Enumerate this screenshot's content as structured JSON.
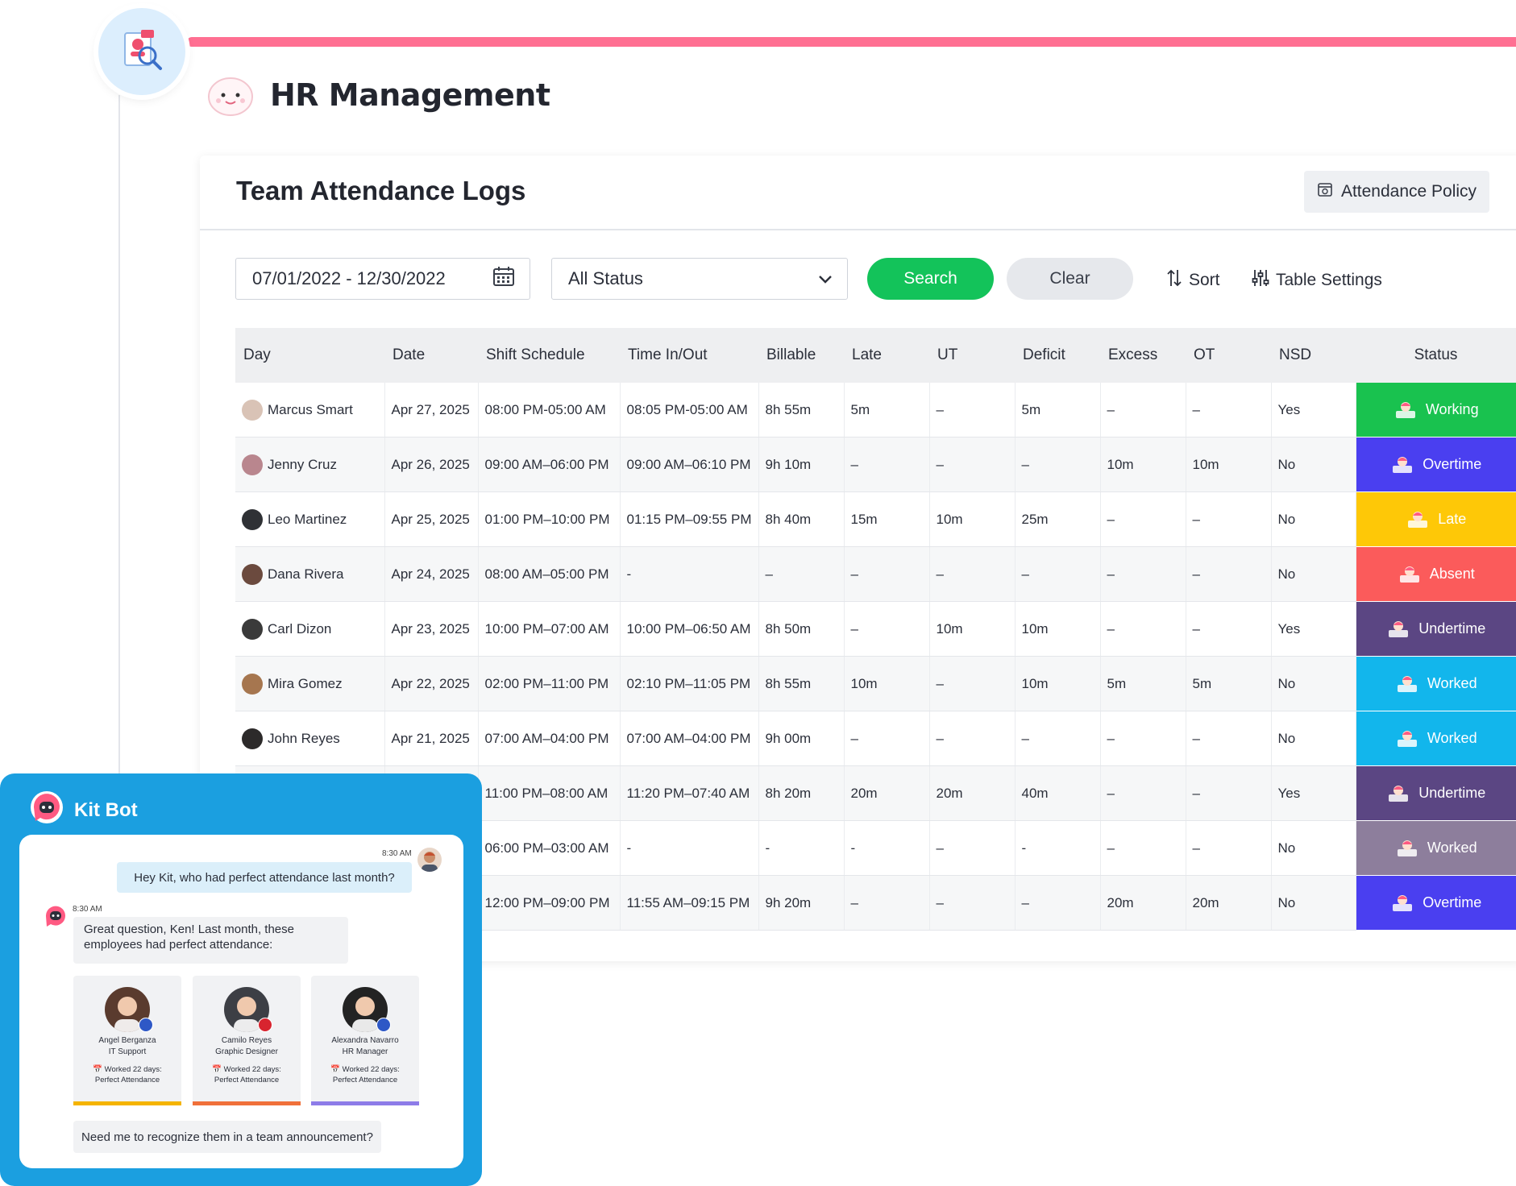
{
  "app": {
    "title": "HR Management"
  },
  "page": {
    "title": "Team Attendance Logs",
    "policy_button": "Attendance Policy"
  },
  "filters": {
    "date_range": "07/01/2022 - 12/30/2022",
    "status_selected": "All Status",
    "search_label": "Search",
    "clear_label": "Clear",
    "sort_label": "Sort",
    "table_settings_label": "Table Settings"
  },
  "table": {
    "headers": [
      "Day",
      "Date",
      "Shift Schedule",
      "Time In/Out",
      "Billable",
      "Late",
      "UT",
      "Deficit",
      "Excess",
      "OT",
      "NSD",
      "Status"
    ],
    "rows": [
      {
        "name": "Marcus Smart",
        "date": "Apr 27, 2025",
        "shift": "08:00 PM-05:00 AM",
        "timeio": "08:05 PM-05:00 AM",
        "billable": "8h 55m",
        "late": "5m",
        "ut": "–",
        "deficit": "5m",
        "excess": "–",
        "ot": "–",
        "nsd": "Yes",
        "status": "Working",
        "status_color": "#19c24f",
        "avatar_color": "#d9c3b6"
      },
      {
        "name": "Jenny Cruz",
        "date": "Apr 26, 2025",
        "shift": "09:00 AM–06:00 PM",
        "timeio": "09:00 AM–06:10 PM",
        "billable": "9h 10m",
        "late": "–",
        "ut": "–",
        "deficit": "–",
        "excess": "10m",
        "ot": "10m",
        "nsd": "No",
        "status": "Overtime",
        "status_color": "#4a3ff0",
        "avatar_color": "#b9868e"
      },
      {
        "name": "Leo Martinez",
        "date": "Apr 25, 2025",
        "shift": "01:00 PM–10:00 PM",
        "timeio": "01:15 PM–09:55 PM",
        "billable": "8h 40m",
        "late": "15m",
        "ut": "10m",
        "deficit": "25m",
        "excess": "–",
        "ot": "–",
        "nsd": "No",
        "status": "Late",
        "status_color": "#fec807",
        "avatar_color": "#2f3135"
      },
      {
        "name": "Dana Rivera",
        "date": "Apr 24, 2025",
        "shift": "08:00 AM–05:00 PM",
        "timeio": "-",
        "billable": "–",
        "late": "–",
        "ut": "–",
        "deficit": "–",
        "excess": "–",
        "ot": "–",
        "nsd": "No",
        "status": "Absent",
        "status_color": "#fb5b5b",
        "avatar_color": "#6b4a3e"
      },
      {
        "name": "Carl Dizon",
        "date": "Apr 23, 2025",
        "shift": "10:00 PM–07:00 AM",
        "timeio": "10:00 PM–06:50 AM",
        "billable": "8h 50m",
        "late": "–",
        "ut": "10m",
        "deficit": "10m",
        "excess": "–",
        "ot": "–",
        "nsd": "Yes",
        "status": "Undertime",
        "status_color": "#5b4683",
        "avatar_color": "#3a3a3a"
      },
      {
        "name": "Mira Gomez",
        "date": "Apr 22, 2025",
        "shift": "02:00 PM–11:00 PM",
        "timeio": "02:10 PM–11:05 PM",
        "billable": "8h 55m",
        "late": "10m",
        "ut": "–",
        "deficit": "10m",
        "excess": "5m",
        "ot": "5m",
        "nsd": "No",
        "status": "Worked",
        "status_color": "#12b6ec",
        "avatar_color": "#a6764f"
      },
      {
        "name": "John Reyes",
        "date": "Apr 21, 2025",
        "shift": "07:00 AM–04:00 PM",
        "timeio": "07:00 AM–04:00 PM",
        "billable": "9h 00m",
        "late": "–",
        "ut": "–",
        "deficit": "–",
        "excess": "–",
        "ot": "–",
        "nsd": "No",
        "status": "Worked",
        "status_color": "#12b6ec",
        "avatar_color": "#2c2a2a"
      },
      {
        "name": "",
        "date": "",
        "shift": "11:00 PM–08:00 AM",
        "timeio": "11:20 PM–07:40 AM",
        "billable": "8h 20m",
        "late": "20m",
        "ut": "20m",
        "deficit": "40m",
        "excess": "–",
        "ot": "–",
        "nsd": "Yes",
        "status": "Undertime",
        "status_color": "#5b4683",
        "avatar_color": "#cccccc"
      },
      {
        "name": "",
        "date": "",
        "shift": "06:00 PM–03:00 AM",
        "timeio": "-",
        "billable": "-",
        "late": "-",
        "ut": "–",
        "deficit": "-",
        "excess": "–",
        "ot": "–",
        "nsd": "No",
        "status": "Worked",
        "status_color": "#8d7e9c",
        "avatar_color": "#cccccc"
      },
      {
        "name": "",
        "date": "",
        "shift": "12:00 PM–09:00 PM",
        "timeio": "11:55 AM–09:15 PM",
        "billable": "9h 20m",
        "late": "–",
        "ut": "–",
        "deficit": "–",
        "excess": "20m",
        "ot": "20m",
        "nsd": "No",
        "status": "Overtime",
        "status_color": "#4a3ff0",
        "avatar_color": "#cccccc"
      }
    ]
  },
  "kitbot": {
    "title": "Kit Bot",
    "user_time": "8:30 AM",
    "user_message": "Hey Kit, who had perfect attendance last month?",
    "bot_time": "8:30 AM",
    "bot_message": "Great question, Ken! Last month, these employees had perfect attendance:",
    "employees": [
      {
        "name": "Angel Berganza",
        "role": "IT Support",
        "worked": "Worked 22 days:",
        "note": "Perfect Attendance",
        "bar_color": "#f5b400",
        "photo_color": "#5a3b2e",
        "flag_color": "#2e58c6"
      },
      {
        "name": "Camilo Reyes",
        "role": "Graphic Designer",
        "worked": "Worked 22 days:",
        "note": "Perfect Attendance",
        "bar_color": "#f0703a",
        "photo_color": "#3d3f45",
        "flag_color": "#d8242f"
      },
      {
        "name": "Alexandra Navarro",
        "role": "HR Manager",
        "worked": "Worked 22 days:",
        "note": "Perfect Attendance",
        "bar_color": "#8d7ce8",
        "photo_color": "#232323",
        "flag_color": "#2e58c6"
      }
    ],
    "followup": "Need me to recognize them in a team announcement?"
  }
}
